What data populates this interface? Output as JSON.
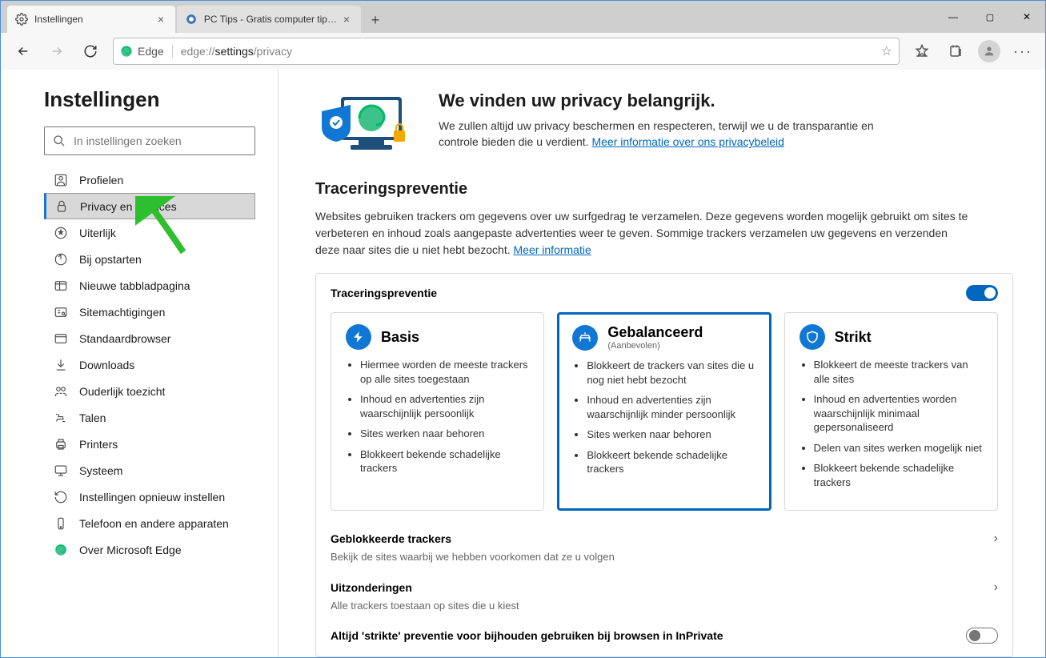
{
  "window": {
    "minimize": "—",
    "maximize": "▢",
    "close": "✕"
  },
  "tabs": [
    {
      "label": "Instellingen"
    },
    {
      "label": "PC Tips - Gratis computer tips! -"
    }
  ],
  "addr": {
    "prefix": "Edge",
    "url_grey_a": "edge://",
    "url_dark": "settings",
    "url_grey_b": "/privacy"
  },
  "sidebar": {
    "title": "Instellingen",
    "search_placeholder": "In instellingen zoeken",
    "items": [
      "Profielen",
      "Privacy en services",
      "Uiterlijk",
      "Bij opstarten",
      "Nieuwe tabbladpagina",
      "Sitemachtigingen",
      "Standaardbrowser",
      "Downloads",
      "Ouderlijk toezicht",
      "Talen",
      "Printers",
      "Systeem",
      "Instellingen opnieuw instellen",
      "Telefoon en andere apparaten",
      "Over Microsoft Edge"
    ]
  },
  "intro": {
    "title": "We vinden uw privacy belangrijk.",
    "body": "We zullen altijd uw privacy beschermen en respecteren, terwijl we u de transparantie en controle bieden die u verdient. ",
    "link": "Meer informatie over ons privacybeleid"
  },
  "tracking": {
    "title": "Traceringspreventie",
    "desc": "Websites gebruiken trackers om gegevens over uw surfgedrag te verzamelen. Deze gegevens worden mogelijk gebruikt om sites te verbeteren en inhoud zoals aangepaste advertenties weer te geven. Sommige trackers verzamelen uw gegevens en verzenden deze naar sites die u niet hebt bezocht. ",
    "link": "Meer informatie",
    "panel_title": "Traceringspreventie",
    "cards": [
      {
        "title": "Basis",
        "sub": "",
        "bullets": [
          "Hiermee worden de meeste trackers op alle sites toegestaan",
          "Inhoud en advertenties zijn waarschijnlijk persoonlijk",
          "Sites werken naar behoren",
          "Blokkeert bekende schadelijke trackers"
        ]
      },
      {
        "title": "Gebalanceerd",
        "sub": "(Aanbevolen)",
        "bullets": [
          "Blokkeert de trackers van sites die u nog niet hebt bezocht",
          "Inhoud en advertenties zijn waarschijnlijk minder persoonlijk",
          "Sites werken naar behoren",
          "Blokkeert bekende schadelijke trackers"
        ]
      },
      {
        "title": "Strikt",
        "sub": "",
        "bullets": [
          "Blokkeert de meeste trackers van alle sites",
          "Inhoud en advertenties worden waarschijnlijk minimaal gepersonaliseerd",
          "Delen van sites werken mogelijk niet",
          "Blokkeert bekende schadelijke trackers"
        ]
      }
    ],
    "blocked": {
      "title": "Geblokkeerde trackers",
      "desc": "Bekijk de sites waarbij we hebben voorkomen dat ze u volgen"
    },
    "except": {
      "title": "Uitzonderingen",
      "desc": "Alle trackers toestaan op sites die u kiest"
    },
    "inprivate": "Altijd 'strikte' preventie voor bijhouden gebruiken bij browsen in InPrivate"
  }
}
